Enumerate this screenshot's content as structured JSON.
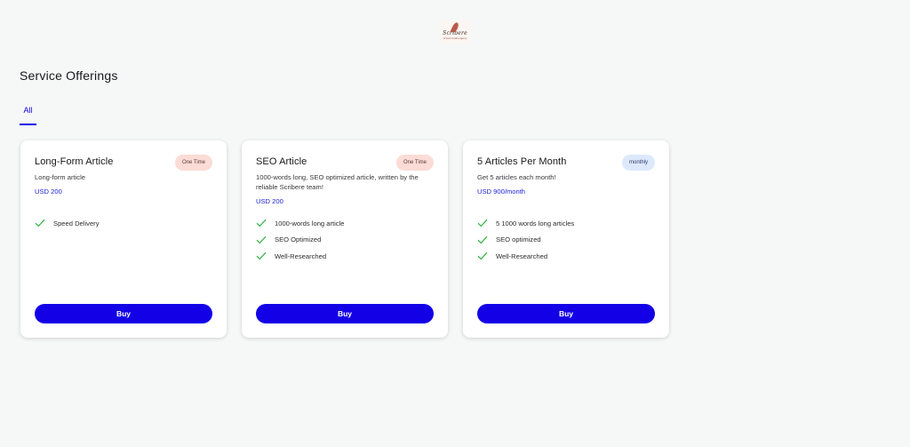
{
  "header": {
    "logo_text": "Scribere",
    "logo_tagline": "Content Creative Agency"
  },
  "page": {
    "title": "Service Offerings"
  },
  "tabs": [
    {
      "label": "All",
      "active": true
    }
  ],
  "colors": {
    "accent": "#1300e6",
    "one_time_badge": "#fbdcd6",
    "monthly_badge": "#dde9fb",
    "check": "#2fb344"
  },
  "cards": [
    {
      "title": "Long-Form Article",
      "badge": "One Time",
      "description": "Long-form article",
      "price": "USD 200",
      "features": [
        "Speed Delivery"
      ],
      "button_label": "Buy"
    },
    {
      "title": "SEO Article",
      "badge": "One Time",
      "description": "1000-words long, SEO optimized article, written by the reliable Scribere team!",
      "price": "USD 200",
      "features": [
        "1000-words long article",
        "SEO Optimized",
        "Well-Researched"
      ],
      "button_label": "Buy"
    },
    {
      "title": "5 Articles Per Month",
      "badge": "monthly",
      "description": "Get 5 articles each month!",
      "price": "USD 900/month",
      "features": [
        "5 1000 words long articles",
        "SEO optimized",
        "Well-Researched"
      ],
      "button_label": "Buy"
    }
  ]
}
